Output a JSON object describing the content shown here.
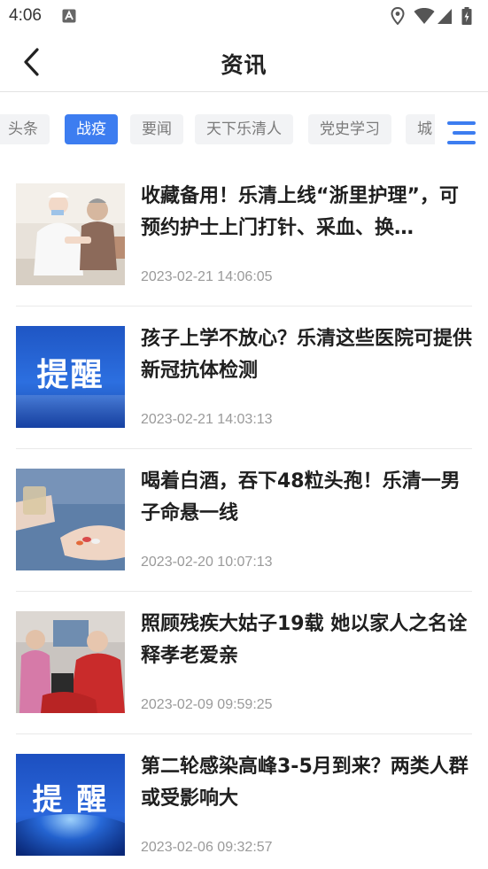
{
  "status_bar": {
    "time": "4:06",
    "left_icon": "accessibility-a-icon",
    "right_icons": [
      "location-icon",
      "wifi-icon",
      "signal-icon",
      "battery-charging-icon"
    ]
  },
  "nav": {
    "title": "资讯",
    "back_icon": "chevron-left-icon"
  },
  "tabs": [
    {
      "label": "头条",
      "active": false
    },
    {
      "label": "战疫",
      "active": true
    },
    {
      "label": "要闻",
      "active": false
    },
    {
      "label": "天下乐清人",
      "active": false
    },
    {
      "label": "党史学习",
      "active": false
    },
    {
      "label": "城",
      "active": false
    }
  ],
  "menu_icon": "menu-lines-icon",
  "colors": {
    "accent": "#3d7df0",
    "tab_bg": "#f2f3f5",
    "tab_text": "#7a7a7a",
    "date_text": "#9a9a9a"
  },
  "news": [
    {
      "headline": "收藏备用！乐清上线“浙里护理”，可预约护士上门打针、采血、换…",
      "date": "2023-02-21 14:06:05",
      "thumb": "nurse-visit-photo"
    },
    {
      "headline": "孩子上学不放心？乐清这些医院可提供新冠抗体检测",
      "date": "2023-02-21 14:03:13",
      "thumb": "reminder-banner",
      "thumb_text": "提醒"
    },
    {
      "headline": "喝着白酒，吞下48粒头孢！乐清一男子命悬一线",
      "date": "2023-02-20 10:07:13",
      "thumb": "pills-in-hand-photo"
    },
    {
      "headline": "照顾残疾大姑子19载 她以家人之名诠释孝老爱亲",
      "date": "2023-02-09 09:59:25",
      "thumb": "family-care-photo"
    },
    {
      "headline": "第二轮感染高峰3-5月到来？两类人群或受影响大",
      "date": "2023-02-06 09:32:57",
      "thumb": "reminder-banner",
      "thumb_text": "提 醒"
    }
  ]
}
